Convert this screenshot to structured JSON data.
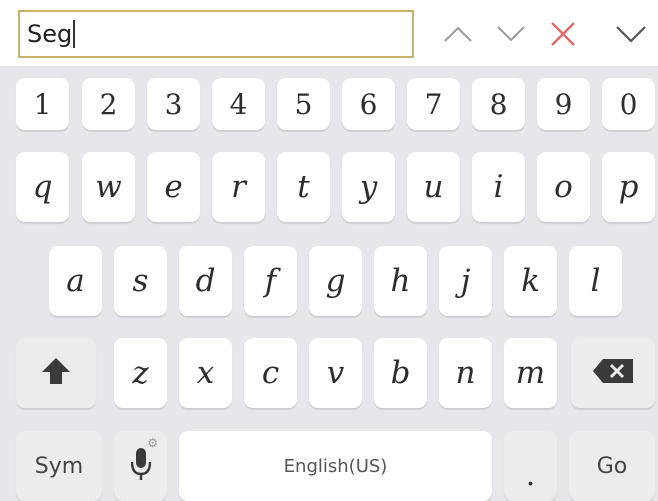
{
  "find_bar": {
    "value": "Seg",
    "border_color": "#c9b36a",
    "icons": [
      "chevron-up-icon",
      "chevron-down-icon",
      "close-icon",
      "collapse-icon"
    ],
    "close_color": "#e06a6a"
  },
  "keyboard": {
    "background": "#e5e7eb",
    "number_row": [
      "1",
      "2",
      "3",
      "4",
      "5",
      "6",
      "7",
      "8",
      "9",
      "0"
    ],
    "row1": [
      "q",
      "w",
      "e",
      "r",
      "t",
      "y",
      "u",
      "i",
      "o",
      "p"
    ],
    "row2": [
      "a",
      "s",
      "d",
      "f",
      "g",
      "h",
      "j",
      "k",
      "l"
    ],
    "row3": [
      "z",
      "x",
      "c",
      "v",
      "b",
      "n",
      "m"
    ],
    "bottom": {
      "sym_label": "Sym",
      "space_label": "English(US)",
      "period_label": ".",
      "go_label": "Go"
    },
    "icons": [
      "shift-icon",
      "backspace-icon",
      "microphone-icon",
      "gear-icon"
    ]
  }
}
